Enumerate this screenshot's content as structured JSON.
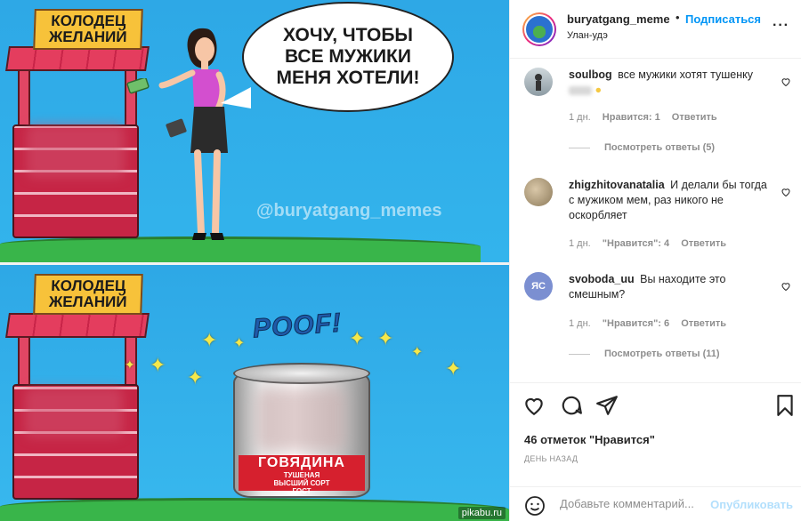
{
  "meme": {
    "top_panel": {
      "well_sign": "КОЛОДЕЦ ЖЕЛАНИЙ",
      "speech_bubble": "ХОЧУ, ЧТОБЫ ВСЕ МУЖИКИ МЕНЯ ХОТЕЛИ!",
      "watermark": "@buryatgang_memes"
    },
    "bottom_panel": {
      "well_sign": "КОЛОДЕЦ ЖЕЛАНИЙ",
      "poof": "POOF!",
      "can_label_main": "ГОВЯДИНА",
      "can_label_sub1": "ТУШЕНАЯ",
      "can_label_sub2": "ВЫСШИЙ СОРТ",
      "can_label_sub3": "ГОСТ"
    },
    "source_watermark": "pikabu.ru"
  },
  "header": {
    "username": "buryatgang_meme",
    "dot": "•",
    "follow": "Подписаться",
    "location": "Улан-удэ",
    "more": "···"
  },
  "comments": [
    {
      "user": "soulbog",
      "text": "все мужики хотят тушенку",
      "time": "1 дн.",
      "likes": "Нравится: 1",
      "reply": "Ответить",
      "view_replies": "Посмотреть ответы (5)"
    },
    {
      "user": "zhigzhitovanatalia",
      "text": "И делали бы тогда с мужиком мем, раз никого не оскорбляет",
      "time": "1 дн.",
      "likes": "\"Нравится\": 4",
      "reply": "Ответить"
    },
    {
      "user": "svoboda_uu",
      "text": "Вы находите это смешным?",
      "avatar_initials": "ЯС",
      "time": "1 дн.",
      "likes": "\"Нравится\": 6",
      "reply": "Ответить",
      "view_replies": "Посмотреть ответы (11)"
    }
  ],
  "actions": {
    "likes": "46 отметок \"Нравится\"",
    "posted": "ДЕНЬ НАЗАД",
    "comment_placeholder": "Добавьте комментарий...",
    "post_button": "Опубликовать"
  },
  "icons": [
    "heart-icon",
    "comment-icon",
    "share-icon",
    "bookmark-icon",
    "smile-icon",
    "more-icon"
  ],
  "colors": {
    "accent": "#0095f6",
    "muted": "#8e8e8e",
    "text": "#262626",
    "sky": "#2fa6e0",
    "grass": "#39b54a"
  }
}
